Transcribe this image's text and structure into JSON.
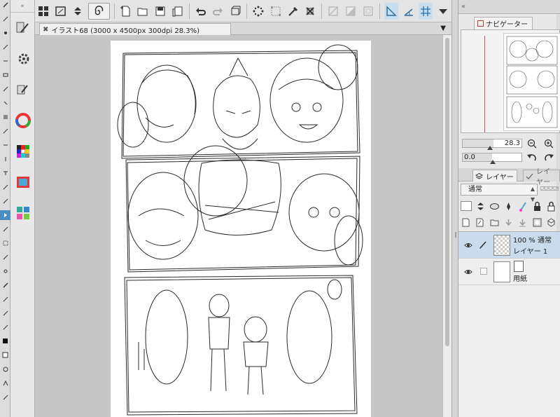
{
  "document": {
    "tab_title": "イラスト68 (3000 x 4500px 300dpi 28.3%)",
    "close_glyph": "✖"
  },
  "toolbar": {
    "icons": [
      "grid-icon",
      "canvas-menu-icon",
      "zoom-stepper-icon",
      "spiral-icon",
      "new-file-icon",
      "open-file-icon",
      "save-icon",
      "duplicate-icon",
      "undo-icon",
      "redo-icon",
      "transform-icon",
      "loading-icon",
      "select-all-icon",
      "eyedropper-icon",
      "deselect-icon",
      "crop-icon",
      "gradient-icon",
      "convert-icon",
      "ruler-snap-icon",
      "special-ruler-icon",
      "grid-snap-icon",
      "dropdown-icon"
    ]
  },
  "navigator": {
    "tab_label": "ナビゲーター",
    "zoom_value": "28.3",
    "rotation_value": "0.0"
  },
  "layer_panel": {
    "tab_label": "レイヤー",
    "tab2_label": "レイヤー",
    "blend_mode": "通常",
    "layers": [
      {
        "line1": "100 % 通常",
        "line2": "レイヤー 1",
        "selected": true
      },
      {
        "line1": "",
        "line2": "用紙",
        "selected": false
      }
    ]
  },
  "colors": {
    "accent": "#4a8ec2",
    "selected_layer": "#c8dcee",
    "active_button": "#c9dff0"
  }
}
